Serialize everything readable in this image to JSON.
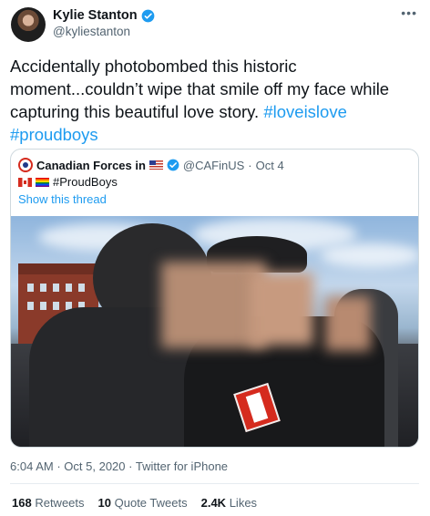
{
  "author": {
    "name": "Kylie Stanton",
    "handle": "@kyliestanton"
  },
  "more_icon": "•••",
  "tweet": {
    "text_prefix": "Accidentally photobombed this historic moment...couldn’t wipe that smile off my face while capturing this beautiful love story. ",
    "hashtag1": "#loveislove",
    "hashtag2": "#proudboys"
  },
  "quote": {
    "name": "Canadian Forces in",
    "handle": "@CAFinUS",
    "separator": "·",
    "date": "Oct 4",
    "text": "#ProudBoys",
    "show_thread": "Show this thread"
  },
  "meta": {
    "time": "6:04 AM",
    "date": "Oct 5, 2020",
    "source": "Twitter for iPhone",
    "separator": "·"
  },
  "stats": {
    "retweets_count": "168",
    "retweets_label": "Retweets",
    "quotes_count": "10",
    "quotes_label": "Quote Tweets",
    "likes_count": "2.4K",
    "likes_label": "Likes"
  },
  "colors": {
    "link": "#1d9bf0",
    "secondary_text": "#536471",
    "verified": "#1d9bf0"
  },
  "icons": [
    "verified-badge-icon",
    "more-icon",
    "us-flag-icon",
    "canada-flag-icon",
    "rainbow-flag-icon"
  ]
}
